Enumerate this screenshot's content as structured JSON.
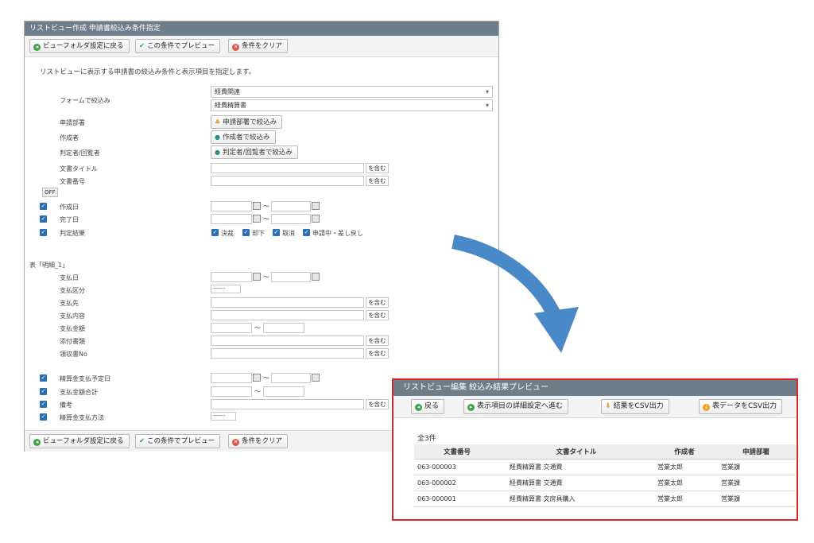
{
  "panel1": {
    "title": "リストビュー作成 申請書絞込み条件指定",
    "btn_back": "ビューフォルダ設定に戻る",
    "btn_preview": "この条件でプレビュー",
    "btn_clear": "条件をクリア",
    "description": "リストビューに表示する申請書の絞込み条件と表示項目を指定します。",
    "form_filter_label": "フォームで絞込み",
    "form_select_1": "経費関連",
    "form_select_2": "経費精算書",
    "dept_label": "申請部署",
    "dept_button": "申請部署で絞込み",
    "author_label": "作成者",
    "author_button": "作成者で絞込み",
    "judge_label": "判定者/回覧者",
    "judge_button": "判定者/回覧者で絞込み",
    "doc_title_label": "文書タイトル",
    "doc_number_label": "文書番号",
    "contains": "を含む",
    "off": "OFF",
    "created_label": "作成日",
    "completed_label": "完了日",
    "result_label": "判定結果",
    "tilde": "～",
    "result_options": [
      "決裁",
      "却下",
      "取消",
      "申請中・差し戻し"
    ],
    "table_header": "表「明細_1」",
    "pay_date": "支払日",
    "pay_type": "支払区分",
    "pay_dest": "支払先",
    "pay_content": "支払内容",
    "pay_amount": "支払金額",
    "attach_type": "添付書類",
    "receipt_no": "領収書No",
    "dashes": "------",
    "sched_pay_date": "精算金支払予定日",
    "pay_total": "支払金額合計",
    "remarks": "備考",
    "pay_method": "精算金支払方法"
  },
  "panel2": {
    "title": "リストビュー編集 絞込み結果プレビュー",
    "btn_back": "戻る",
    "btn_detail": "表示項目の詳細設定へ進む",
    "btn_csv_result": "結果をCSV出力",
    "btn_csv_table": "表データをCSV出力",
    "count": "全3件",
    "columns": [
      "文書番号",
      "文書タイトル",
      "作成者",
      "申請部署"
    ],
    "rows": [
      [
        "063-000003",
        "経費精算書 交通費",
        "営業太郎",
        "営業課"
      ],
      [
        "063-000002",
        "経費精算書 交通費",
        "営業太郎",
        "営業課"
      ],
      [
        "063-000001",
        "経費精算書 文房具購入",
        "営業太郎",
        "営業課"
      ]
    ]
  },
  "colors": {
    "titlebar": "#6f7e8b",
    "arrow": "#4a89c8",
    "highlight": "#e02424"
  }
}
